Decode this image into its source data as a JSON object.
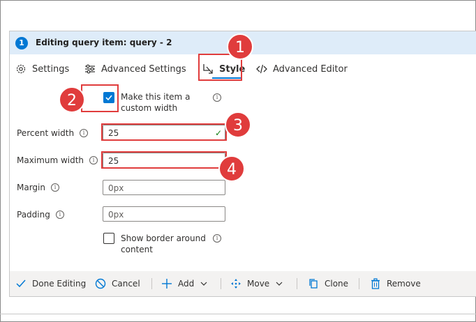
{
  "dialog": {
    "step_number": "1",
    "title": "Editing query item: query - 2"
  },
  "tabs": [
    {
      "label": "Settings",
      "icon": "gear-icon"
    },
    {
      "label": "Advanced Settings",
      "icon": "sliders-icon"
    },
    {
      "label": "Style",
      "icon": "resize-icon",
      "active": true
    },
    {
      "label": "Advanced Editor",
      "icon": "code-icon"
    }
  ],
  "form": {
    "custom_width": {
      "label_line1": "Make this item a",
      "label_line2": "custom width",
      "checked": true
    },
    "percent_width": {
      "label": "Percent width",
      "value": "25"
    },
    "maximum_width": {
      "label": "Maximum width",
      "value": "25"
    },
    "margin": {
      "label": "Margin",
      "placeholder": "0px"
    },
    "padding": {
      "label": "Padding",
      "placeholder": "0px"
    },
    "show_border": {
      "label_line1": "Show border around",
      "label_line2": "content",
      "checked": false
    }
  },
  "footer": {
    "done": "Done Editing",
    "cancel": "Cancel",
    "add": "Add",
    "move": "Move",
    "clone": "Clone",
    "remove": "Remove"
  },
  "callouts": [
    "1",
    "2",
    "3",
    "4"
  ],
  "colors": {
    "accent": "#0078d4",
    "callout": "#e03c3c",
    "header_bg": "#deecf9",
    "footer_bg": "#f3f2f1",
    "valid": "#107c10"
  }
}
